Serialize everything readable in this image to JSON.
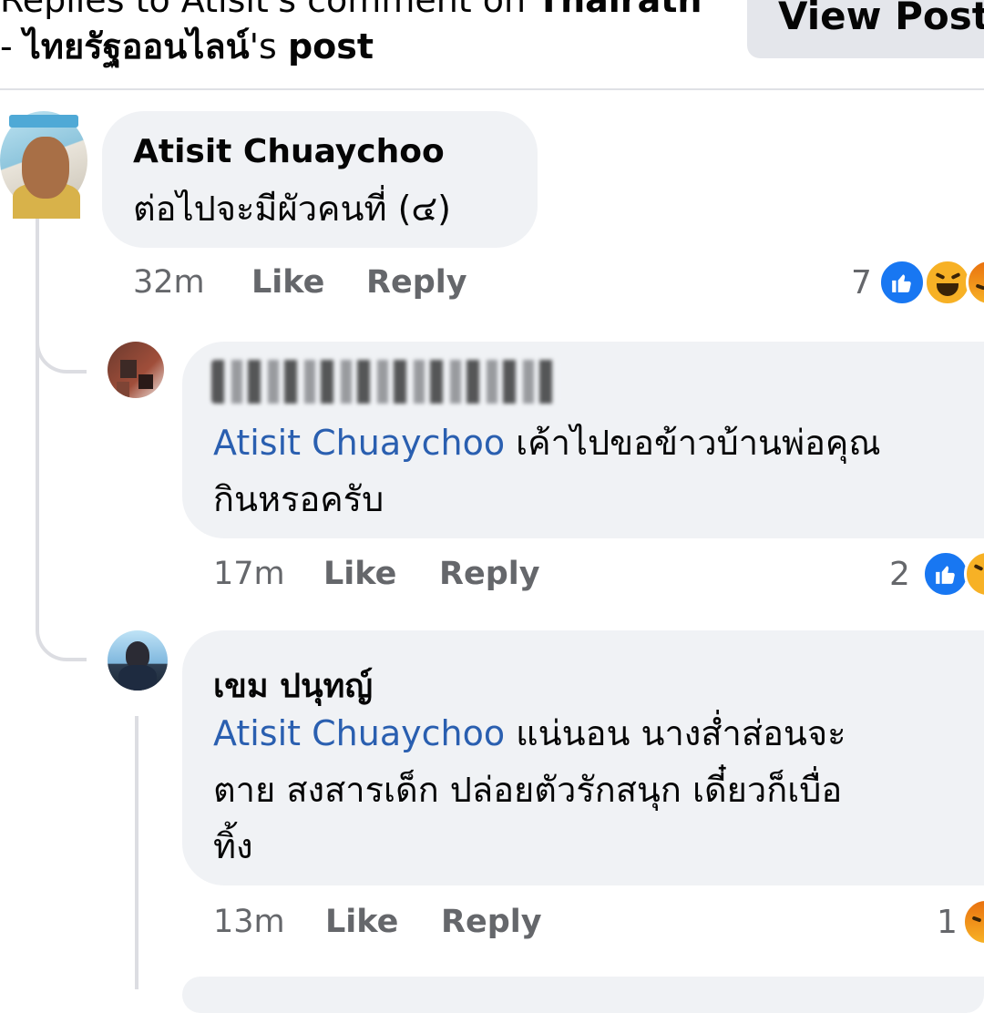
{
  "header": {
    "line1_prefix": "Replies to Atisit's comment on ",
    "line1_page": "Thairath",
    "line2_prefix": "- ",
    "line2_page": "ไทยรัฐออนไลน์",
    "line2_suffix": "'s ",
    "line2_post": "post",
    "view_post_label": "View Post"
  },
  "comments": [
    {
      "author": "Atisit Chuaychoo",
      "text": "ต่อไปจะมีผัวคนที่  (๔)",
      "time": "32m",
      "like_label": "Like",
      "reply_label": "Reply",
      "reaction_count": "7",
      "reactions": [
        "like-icon",
        "haha-icon",
        "angry-icon"
      ]
    },
    {
      "author": "พูนศักดิ์ ทองประเสริฐ",
      "author_blurred": true,
      "mention": "Atisit Chuaychoo",
      "text_line1": "เค้าไปขอข้าวบ้านพ่อคุณ",
      "text_line2": "กินหรอครับ",
      "time": "17m",
      "like_label": "Like",
      "reply_label": "Reply",
      "reaction_count": "2",
      "reactions": [
        "like-icon",
        "haha-icon"
      ]
    },
    {
      "author": "เขม ปนุทญ์",
      "mention": "Atisit Chuaychoo",
      "text_line1": "แน่นอน นางส่ำส่อนจะ",
      "text_line2": "ตาย สงสารเด็ก ปล่อยตัวรักสนุก เดี๋ยวก็เบื่อ",
      "text_line3": "ทิ้ง",
      "time": "13m",
      "like_label": "Like",
      "reply_label": "Reply",
      "reaction_count": "1",
      "reactions": [
        "angry-icon"
      ]
    }
  ],
  "colors": {
    "bubble": "#f0f2f5",
    "mention": "#2a5fb0",
    "meta": "#65676b",
    "like": "#1877f2",
    "haha": "#f7b125"
  }
}
